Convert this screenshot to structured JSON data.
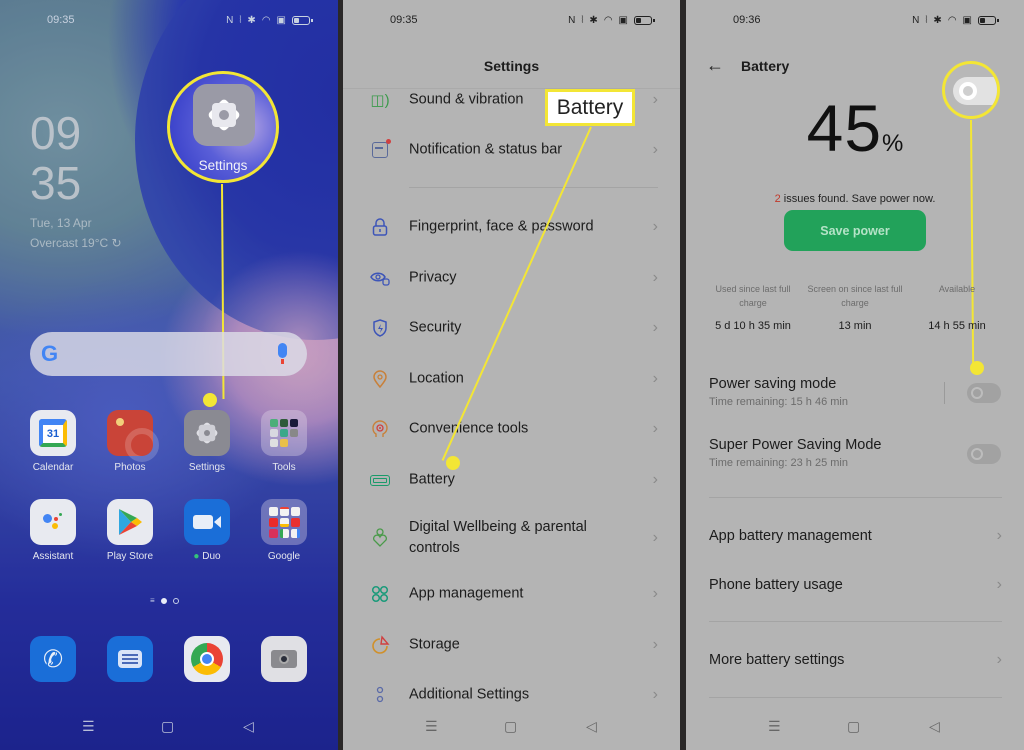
{
  "panel_home": {
    "status_time": "09:35",
    "status_icons": [
      "nfc-icon",
      "vibrate-icon",
      "bluetooth-icon",
      "wifi-icon",
      "sim-icon",
      "battery-icon"
    ],
    "clock_hour": "09",
    "clock_minute": "35",
    "date": "Tue, 13 Apr",
    "weather": "Overcast 19°C",
    "search_logo": "G",
    "callout_label": "Settings",
    "apps_row1": [
      {
        "label": "Calendar",
        "icon": "calendar-icon",
        "badge": "31"
      },
      {
        "label": "Photos",
        "icon": "photos-icon"
      },
      {
        "label": "Settings",
        "icon": "settings-gear-icon"
      },
      {
        "label": "Tools",
        "icon": "tools-folder-icon"
      }
    ],
    "apps_row2": [
      {
        "label": "Assistant",
        "icon": "assistant-icon"
      },
      {
        "label": "Play Store",
        "icon": "play-store-icon"
      },
      {
        "label": "Duo",
        "icon": "duo-icon"
      },
      {
        "label": "Google",
        "icon": "google-folder-icon"
      }
    ],
    "dock": [
      {
        "icon": "phone-icon"
      },
      {
        "icon": "messages-icon"
      },
      {
        "icon": "chrome-icon"
      },
      {
        "icon": "camera-icon"
      }
    ]
  },
  "panel_settings": {
    "status_time": "09:35",
    "title": "Settings",
    "callout_label": "Battery",
    "items": [
      {
        "label": "Sound & vibration",
        "icon": "speaker-icon",
        "color": "#3a9a4a"
      },
      {
        "label": "Notification & status bar",
        "icon": "notification-icon",
        "color": "#5a6a9a"
      },
      {
        "label": "Fingerprint, face & password",
        "icon": "lock-icon",
        "color": "#3d55b8"
      },
      {
        "label": "Privacy",
        "icon": "privacy-eye-icon",
        "color": "#3d55b8"
      },
      {
        "label": "Security",
        "icon": "shield-icon",
        "color": "#3d55b8"
      },
      {
        "label": "Location",
        "icon": "location-pin-icon",
        "color": "#c8803a"
      },
      {
        "label": "Convenience tools",
        "icon": "convenience-head-icon",
        "color": "#c8803a"
      },
      {
        "label": "Battery",
        "icon": "battery-icon",
        "color": "#1a9a6a"
      },
      {
        "label": "Digital Wellbeing & parental controls",
        "icon": "wellbeing-icon",
        "color": "#4a9a4a"
      },
      {
        "label": "App management",
        "icon": "app-grid-icon",
        "color": "#1a9a7a"
      },
      {
        "label": "Storage",
        "icon": "storage-pie-icon",
        "color": "#d0902a"
      },
      {
        "label": "Additional Settings",
        "icon": "more-dots-icon",
        "color": "#5a6aa8"
      }
    ]
  },
  "panel_battery": {
    "status_time": "09:36",
    "title": "Battery",
    "percent": "45",
    "percent_sign": "%",
    "issues_count": "2",
    "issues_text": " issues found. Save power now.",
    "save_button": "Save power",
    "stats": [
      {
        "label": "Used since last full charge",
        "value": "5 d 10 h 35 min"
      },
      {
        "label": "Screen on since last full charge",
        "value": "13 min"
      },
      {
        "label": "Available",
        "value": "14 h 55 min"
      }
    ],
    "modes": [
      {
        "title": "Power saving mode",
        "subtitle": "Time remaining:  15 h 46 min",
        "enabled": false
      },
      {
        "title": "Super Power Saving Mode",
        "subtitle": "Time remaining:  23 h 25 min",
        "enabled": false
      }
    ],
    "links": [
      {
        "label": "App battery management"
      },
      {
        "label": "Phone battery usage"
      },
      {
        "label": "More battery settings"
      }
    ]
  },
  "colors": {
    "callout": "#f3e635",
    "save_button": "#22a25a",
    "issues_count": "#c0392b"
  }
}
